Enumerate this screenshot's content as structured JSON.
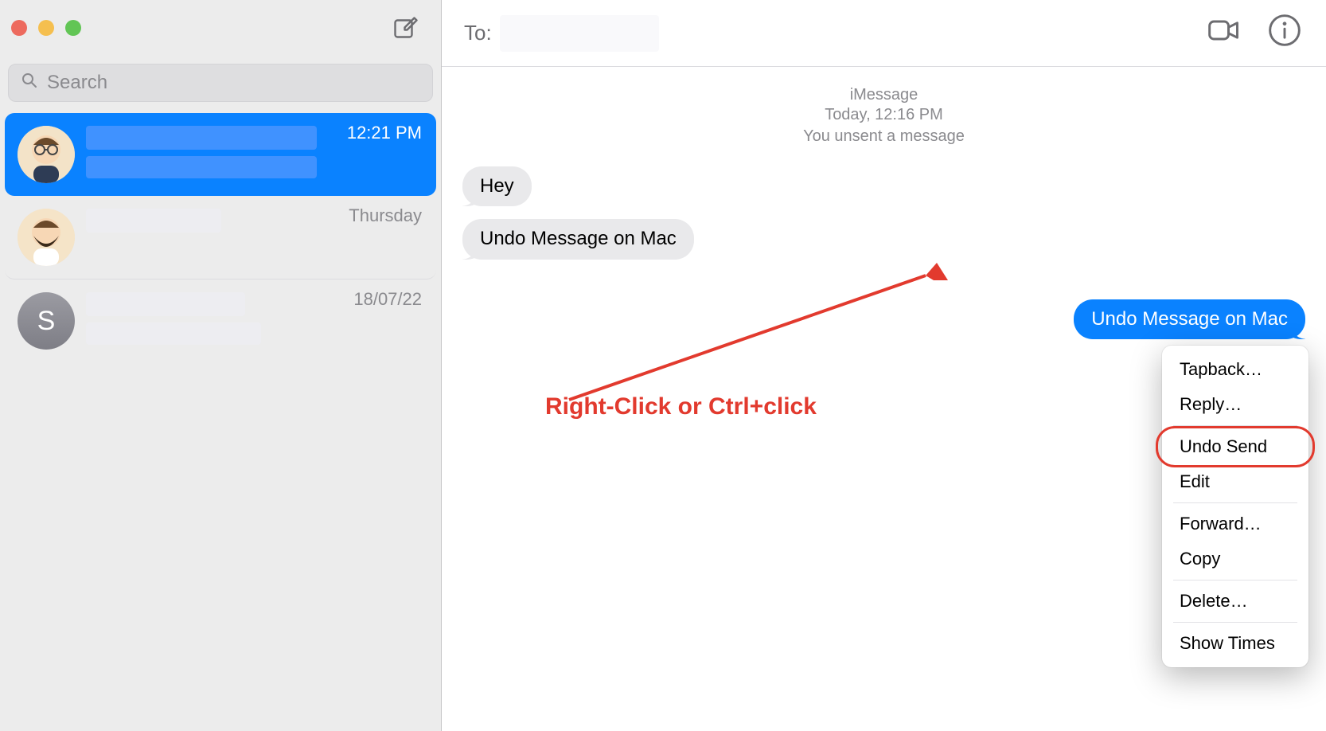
{
  "search": {
    "placeholder": "Search"
  },
  "conversations": [
    {
      "time": "12:21 PM",
      "selected": true,
      "avatar_type": "memoji1"
    },
    {
      "time": "Thursday",
      "selected": false,
      "avatar_type": "memoji2"
    },
    {
      "time": "18/07/22",
      "selected": false,
      "avatar_type": "letter",
      "initial": "S"
    }
  ],
  "header": {
    "to_label": "To:"
  },
  "meta": {
    "service": "iMessage",
    "time": "Today, 12:16 PM",
    "status": "You unsent a message"
  },
  "messages": [
    {
      "dir": "in",
      "text": "Hey"
    },
    {
      "dir": "in",
      "text": "Undo Message on Mac"
    },
    {
      "dir": "out",
      "text": "Undo Message on Mac"
    }
  ],
  "context_menu": {
    "items": [
      "Tapback…",
      "Reply…",
      "---",
      "Undo Send",
      "Edit",
      "---",
      "Forward…",
      "Copy",
      "---",
      "Delete…",
      "---",
      "Show Times"
    ],
    "highlight": "Undo Send"
  },
  "annotation": {
    "label": "Right-Click or Ctrl+click"
  }
}
